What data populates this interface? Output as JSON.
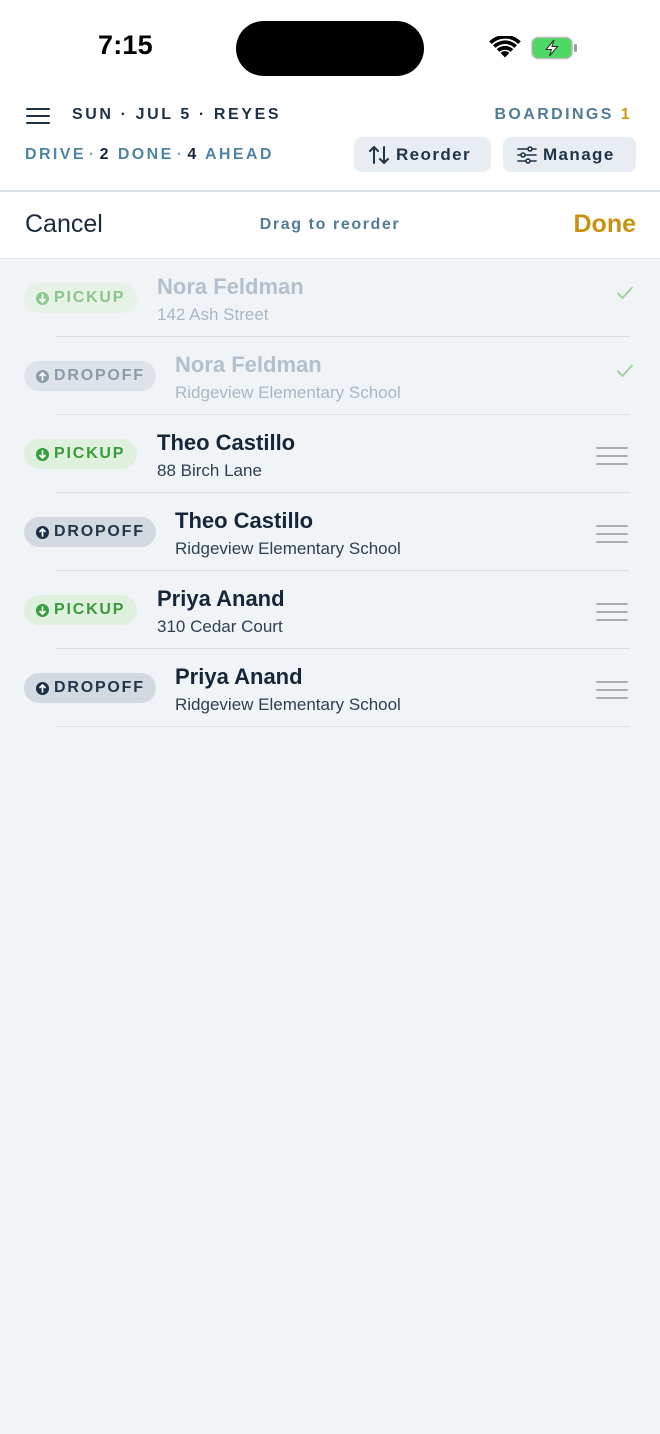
{
  "status_bar": {
    "time": "7:15",
    "icons": [
      "wifi-icon",
      "battery-charging-icon"
    ],
    "battery_color": "#4cd964"
  },
  "header": {
    "title": "SUN · JUL 5 · REYES",
    "boardings_label": "BOARDINGS",
    "boardings_count": "1",
    "drive_label": "DRIVE",
    "done_count": "2",
    "done_label": "DONE",
    "ahead_count": "4",
    "ahead_label": "AHEAD",
    "reorder_label": "Reorder",
    "manage_label": "Manage"
  },
  "edit_bar": {
    "cancel_label": "Cancel",
    "hint": "Drag to reorder",
    "done_label": "Done"
  },
  "colors": {
    "accent": "#c9920f",
    "pickup": "#36a03a",
    "dropoff": "#1d2f44",
    "muted_blue": "#4f7c96"
  },
  "stops": [
    {
      "type": "PICKUP",
      "name": "Nora Feldman",
      "address": "142 Ash Street",
      "completed": true
    },
    {
      "type": "DROPOFF",
      "name": "Nora Feldman",
      "address": "Ridgeview Elementary School",
      "completed": true
    },
    {
      "type": "PICKUP",
      "name": "Theo Castillo",
      "address": "88 Birch Lane",
      "completed": false
    },
    {
      "type": "DROPOFF",
      "name": "Theo Castillo",
      "address": "Ridgeview Elementary School",
      "completed": false
    },
    {
      "type": "PICKUP",
      "name": "Priya Anand",
      "address": "310 Cedar Court",
      "completed": false
    },
    {
      "type": "DROPOFF",
      "name": "Priya Anand",
      "address": "Ridgeview Elementary School",
      "completed": false
    }
  ]
}
